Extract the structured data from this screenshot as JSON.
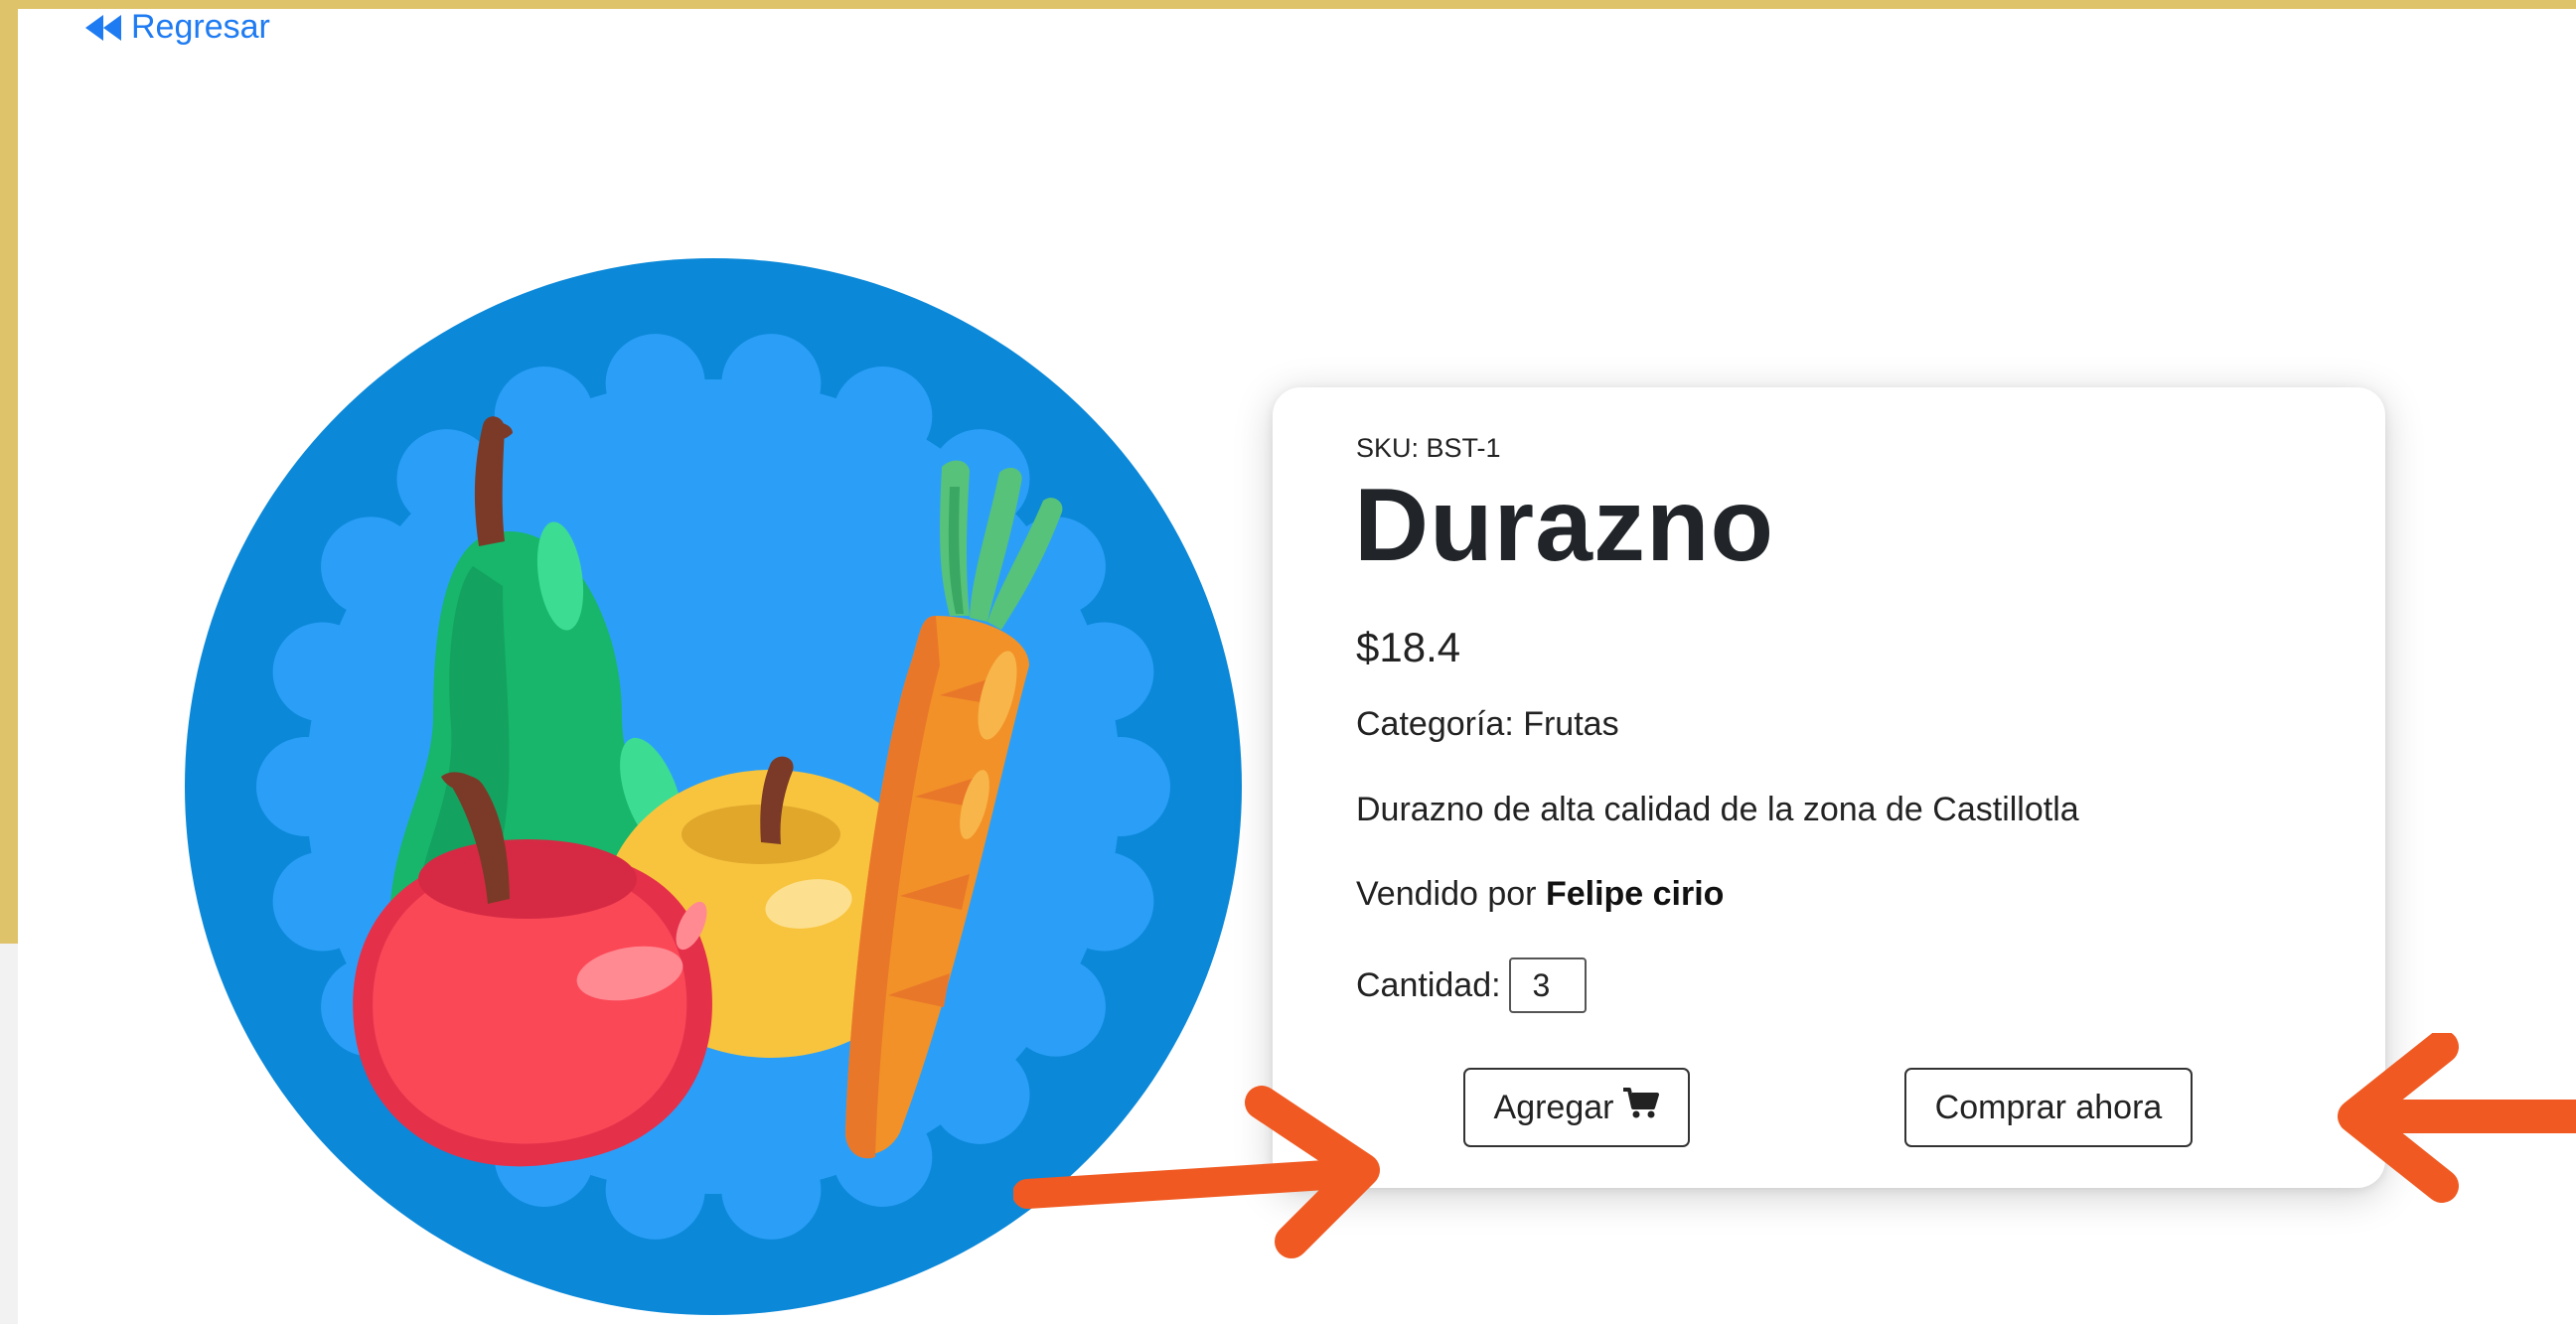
{
  "nav": {
    "back_label": "Regresar"
  },
  "product": {
    "sku": "SKU: BST-1",
    "name": "Durazno",
    "price": "$18.4",
    "category": "Categoría: Frutas",
    "description": "Durazno de alta calidad de la zona de Castillotla",
    "seller_prefix": "Vendido por",
    "seller_name": "Felipe cirio",
    "quantity_label": "Cantidad:",
    "quantity_value": "3"
  },
  "actions": {
    "add_label": "Agregar",
    "buy_label": "Comprar ahora"
  },
  "icons": {
    "back": "double-chevron-left-icon",
    "cart": "shopping-cart-icon"
  },
  "colors": {
    "frame": "#dfc36a",
    "link": "#1e7bf2",
    "arrow": "#f05a22",
    "image_outer": "#0b88d8",
    "image_inner": "#2b9ff8"
  }
}
